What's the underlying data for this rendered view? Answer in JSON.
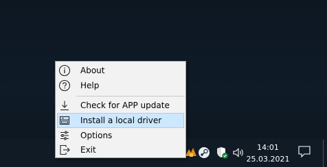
{
  "menu": {
    "items": [
      {
        "label": "About",
        "icon": "info-icon"
      },
      {
        "label": "Help",
        "icon": "help-icon"
      },
      {
        "label": "Check for APP update",
        "icon": "download-icon"
      },
      {
        "label": "Install a local driver",
        "icon": "drive-icon",
        "highlighted": true
      },
      {
        "label": "Options",
        "icon": "sliders-icon"
      },
      {
        "label": "Exit",
        "icon": "exit-icon"
      }
    ],
    "highlight_color": "#cce8ff",
    "highlight_border": "#99d1ff"
  },
  "taskbar": {
    "time": "14:01",
    "date": "25.03.2021",
    "tray_icons": [
      "app-tray-icon",
      "steam-icon",
      "windows-security-icon",
      "volume-icon"
    ],
    "background": "#101b26"
  }
}
